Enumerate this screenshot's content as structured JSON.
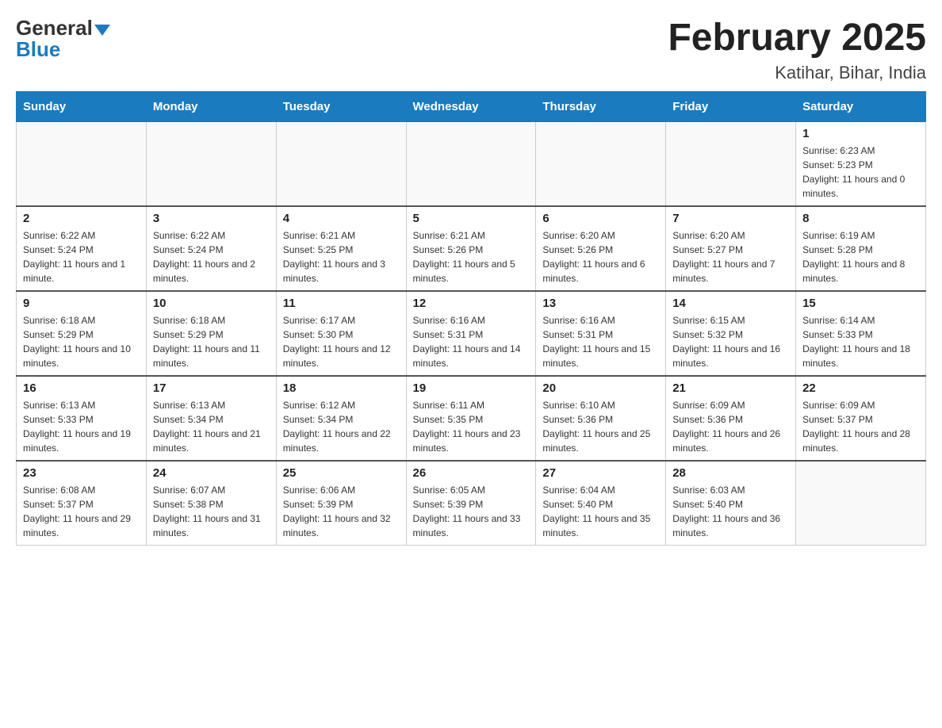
{
  "header": {
    "logo_general": "General",
    "logo_blue": "Blue",
    "month_year": "February 2025",
    "location": "Katihar, Bihar, India"
  },
  "days_of_week": [
    "Sunday",
    "Monday",
    "Tuesday",
    "Wednesday",
    "Thursday",
    "Friday",
    "Saturday"
  ],
  "weeks": [
    [
      {
        "day": "",
        "info": ""
      },
      {
        "day": "",
        "info": ""
      },
      {
        "day": "",
        "info": ""
      },
      {
        "day": "",
        "info": ""
      },
      {
        "day": "",
        "info": ""
      },
      {
        "day": "",
        "info": ""
      },
      {
        "day": "1",
        "info": "Sunrise: 6:23 AM\nSunset: 5:23 PM\nDaylight: 11 hours and 0 minutes."
      }
    ],
    [
      {
        "day": "2",
        "info": "Sunrise: 6:22 AM\nSunset: 5:24 PM\nDaylight: 11 hours and 1 minute."
      },
      {
        "day": "3",
        "info": "Sunrise: 6:22 AM\nSunset: 5:24 PM\nDaylight: 11 hours and 2 minutes."
      },
      {
        "day": "4",
        "info": "Sunrise: 6:21 AM\nSunset: 5:25 PM\nDaylight: 11 hours and 3 minutes."
      },
      {
        "day": "5",
        "info": "Sunrise: 6:21 AM\nSunset: 5:26 PM\nDaylight: 11 hours and 5 minutes."
      },
      {
        "day": "6",
        "info": "Sunrise: 6:20 AM\nSunset: 5:26 PM\nDaylight: 11 hours and 6 minutes."
      },
      {
        "day": "7",
        "info": "Sunrise: 6:20 AM\nSunset: 5:27 PM\nDaylight: 11 hours and 7 minutes."
      },
      {
        "day": "8",
        "info": "Sunrise: 6:19 AM\nSunset: 5:28 PM\nDaylight: 11 hours and 8 minutes."
      }
    ],
    [
      {
        "day": "9",
        "info": "Sunrise: 6:18 AM\nSunset: 5:29 PM\nDaylight: 11 hours and 10 minutes."
      },
      {
        "day": "10",
        "info": "Sunrise: 6:18 AM\nSunset: 5:29 PM\nDaylight: 11 hours and 11 minutes."
      },
      {
        "day": "11",
        "info": "Sunrise: 6:17 AM\nSunset: 5:30 PM\nDaylight: 11 hours and 12 minutes."
      },
      {
        "day": "12",
        "info": "Sunrise: 6:16 AM\nSunset: 5:31 PM\nDaylight: 11 hours and 14 minutes."
      },
      {
        "day": "13",
        "info": "Sunrise: 6:16 AM\nSunset: 5:31 PM\nDaylight: 11 hours and 15 minutes."
      },
      {
        "day": "14",
        "info": "Sunrise: 6:15 AM\nSunset: 5:32 PM\nDaylight: 11 hours and 16 minutes."
      },
      {
        "day": "15",
        "info": "Sunrise: 6:14 AM\nSunset: 5:33 PM\nDaylight: 11 hours and 18 minutes."
      }
    ],
    [
      {
        "day": "16",
        "info": "Sunrise: 6:13 AM\nSunset: 5:33 PM\nDaylight: 11 hours and 19 minutes."
      },
      {
        "day": "17",
        "info": "Sunrise: 6:13 AM\nSunset: 5:34 PM\nDaylight: 11 hours and 21 minutes."
      },
      {
        "day": "18",
        "info": "Sunrise: 6:12 AM\nSunset: 5:34 PM\nDaylight: 11 hours and 22 minutes."
      },
      {
        "day": "19",
        "info": "Sunrise: 6:11 AM\nSunset: 5:35 PM\nDaylight: 11 hours and 23 minutes."
      },
      {
        "day": "20",
        "info": "Sunrise: 6:10 AM\nSunset: 5:36 PM\nDaylight: 11 hours and 25 minutes."
      },
      {
        "day": "21",
        "info": "Sunrise: 6:09 AM\nSunset: 5:36 PM\nDaylight: 11 hours and 26 minutes."
      },
      {
        "day": "22",
        "info": "Sunrise: 6:09 AM\nSunset: 5:37 PM\nDaylight: 11 hours and 28 minutes."
      }
    ],
    [
      {
        "day": "23",
        "info": "Sunrise: 6:08 AM\nSunset: 5:37 PM\nDaylight: 11 hours and 29 minutes."
      },
      {
        "day": "24",
        "info": "Sunrise: 6:07 AM\nSunset: 5:38 PM\nDaylight: 11 hours and 31 minutes."
      },
      {
        "day": "25",
        "info": "Sunrise: 6:06 AM\nSunset: 5:39 PM\nDaylight: 11 hours and 32 minutes."
      },
      {
        "day": "26",
        "info": "Sunrise: 6:05 AM\nSunset: 5:39 PM\nDaylight: 11 hours and 33 minutes."
      },
      {
        "day": "27",
        "info": "Sunrise: 6:04 AM\nSunset: 5:40 PM\nDaylight: 11 hours and 35 minutes."
      },
      {
        "day": "28",
        "info": "Sunrise: 6:03 AM\nSunset: 5:40 PM\nDaylight: 11 hours and 36 minutes."
      },
      {
        "day": "",
        "info": ""
      }
    ]
  ]
}
